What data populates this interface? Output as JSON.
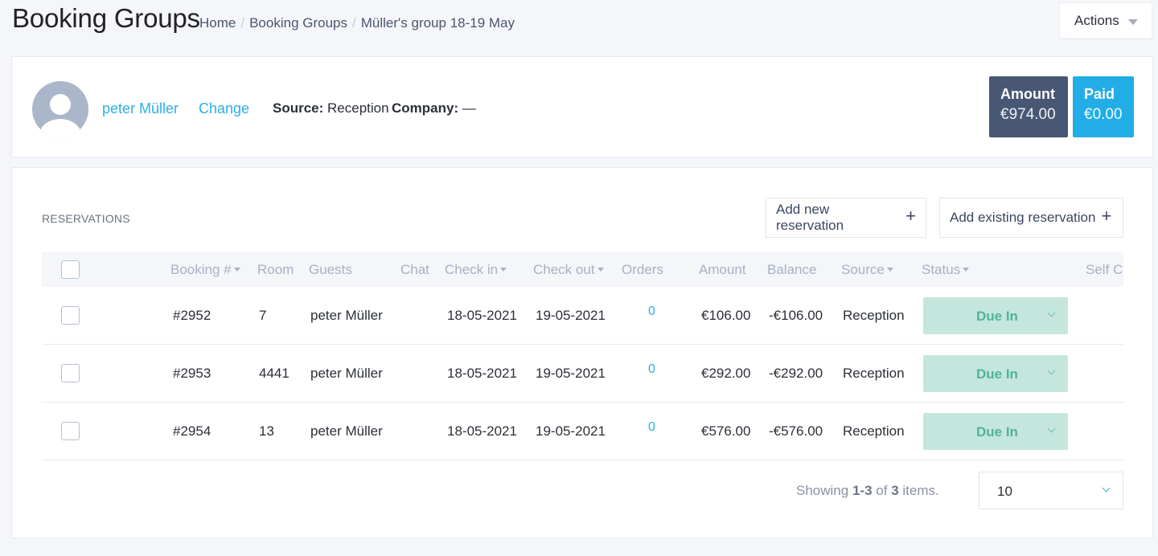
{
  "header": {
    "title": "Booking Groups",
    "breadcrumb": [
      "Home",
      "Booking Groups",
      "Müller's group 18-19 May"
    ],
    "breadcrumb_separator": "/",
    "actions_label": "Actions"
  },
  "profile": {
    "avatar_icon": "user-avatar-placeholder",
    "guest_name": "peter Müller",
    "change_label": "Change",
    "source_label": "Source:",
    "source_value": "Reception",
    "company_label": "Company:",
    "company_value": "—",
    "amount_label": "Amount",
    "amount_value": "€974.00",
    "paid_label": "Paid",
    "paid_value": "€0.00",
    "colors": {
      "amount_bg": "#475774",
      "paid_bg": "#22ade6",
      "link": "#2bb0e6"
    }
  },
  "reservations": {
    "title": "RESERVATIONS",
    "add_new_label": "Add new reservation",
    "add_existing_label": "Add existing reservation",
    "plus_icon": "+",
    "columns": [
      "Booking #",
      "Room",
      "Guests",
      "Chat",
      "Check in",
      "Check out",
      "Orders",
      "Amount",
      "Balance",
      "Source",
      "Status",
      "Self Ch"
    ],
    "rows": [
      {
        "booking": "#2952",
        "room": "7",
        "guest": "peter Müller",
        "check_in": "18-05-2021",
        "check_out": "19-05-2021",
        "orders": "0",
        "amount": "€106.00",
        "balance": "-€106.00",
        "source": "Reception",
        "status": "Due In"
      },
      {
        "booking": "#2953",
        "room": "4441",
        "guest": "peter Müller",
        "check_in": "18-05-2021",
        "check_out": "19-05-2021",
        "orders": "0",
        "amount": "€292.00",
        "balance": "-€292.00",
        "source": "Reception",
        "status": "Due In"
      },
      {
        "booking": "#2954",
        "room": "13",
        "guest": "peter Müller",
        "check_in": "18-05-2021",
        "check_out": "19-05-2021",
        "orders": "0",
        "amount": "€576.00",
        "balance": "-€576.00",
        "source": "Reception",
        "status": "Due In"
      }
    ],
    "status_color": "#c5e6dd",
    "pager": {
      "showing": "Showing",
      "range": "1-3",
      "of": "of",
      "total": "3",
      "items": "items.",
      "page_size": "10"
    }
  }
}
